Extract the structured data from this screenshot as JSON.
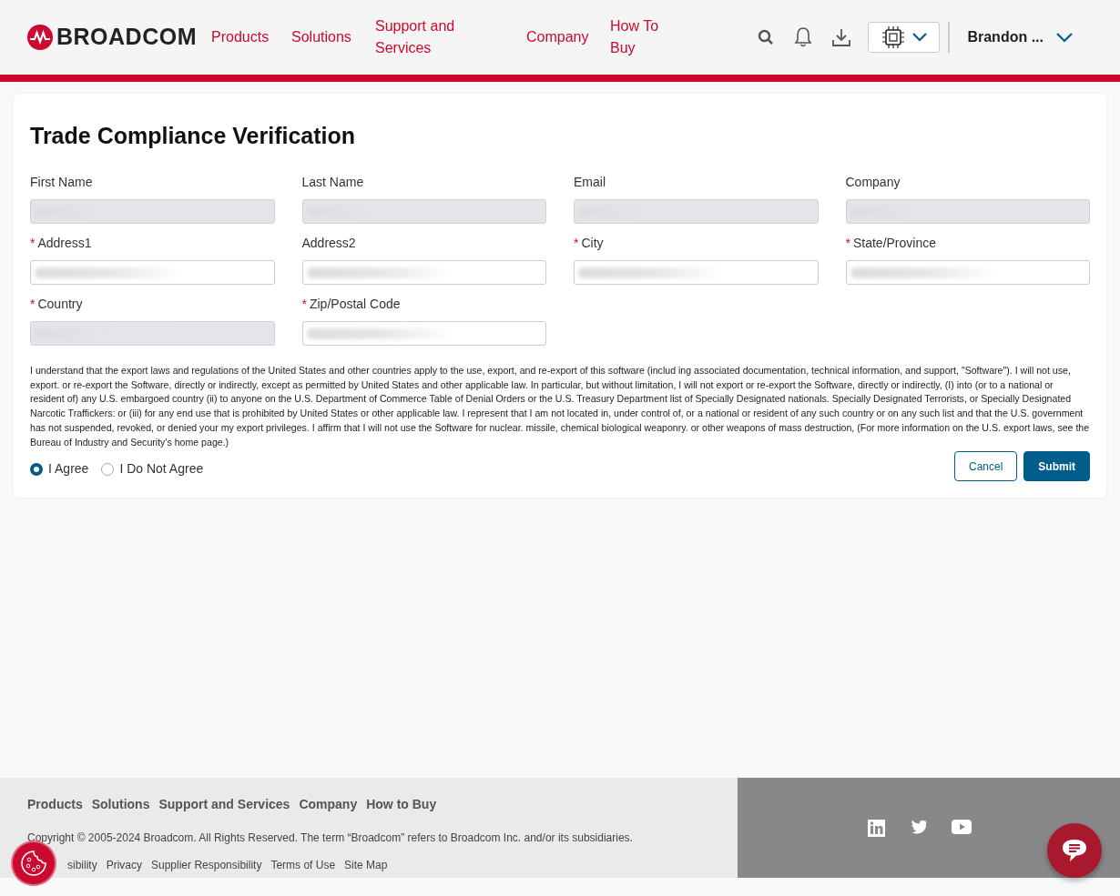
{
  "header": {
    "logo": "BROADCOM",
    "nav": [
      {
        "label": "Products"
      },
      {
        "label": "Solutions"
      },
      {
        "label": "Support and Services"
      },
      {
        "label": "Company"
      },
      {
        "label": "How To Buy"
      }
    ],
    "user": "Brandon ..."
  },
  "form": {
    "title": "Trade Compliance Verification",
    "fields": [
      {
        "label": "First Name",
        "required": false,
        "disabled": true,
        "redacted": true
      },
      {
        "label": "Last Name",
        "required": false,
        "disabled": true,
        "redacted": true
      },
      {
        "label": "Email",
        "required": false,
        "disabled": true,
        "redacted": true
      },
      {
        "label": "Company",
        "required": false,
        "disabled": true,
        "redacted": true
      },
      {
        "label": "Address1",
        "required": true,
        "disabled": false,
        "redacted": true
      },
      {
        "label": "Address2",
        "required": false,
        "disabled": false,
        "redacted": true
      },
      {
        "label": "City",
        "required": true,
        "disabled": false,
        "redacted": true
      },
      {
        "label": "State/Province",
        "required": true,
        "disabled": false,
        "redacted": true
      },
      {
        "label": "Country",
        "required": true,
        "disabled": true,
        "redacted": true
      },
      {
        "label": "Zip/Postal Code",
        "required": true,
        "disabled": false,
        "redacted": true
      }
    ],
    "required_mark": "*",
    "legal_text": "I understand that the export laws and regulations of the United States and other countries apply to the use, export, and re-export of this software (includ ing associated documentation, technical information, and support, \"Software\"). I will not use, export. or re-export the Software, directly or indirectly, except as permitted by United States and other applicable law. In particular, but without limitation, I will not export or re-export the Software, directly or indirectly, (I) into (or to a national or resident of) any U.S. embargoed country (ii) to anyone on the U.S. Department of Commerce Table of Denial Orders or the U.S. Treasury Department list of Specially Designated nationals. Specially Designated Terrorists, or Specially Designated Narcotic Traffickers: or (iii) for any end use that is prohibited by United States or other applicable law. I represent that I am not located in, under control of, or a national or resident of any such country or on any such list and that the U.S. government has not suspended, revoked, or denied your my export privileges. I affirm that I will not use the Software for nuclear. missile, chemical biological weaponry. or other weapons of mass destruction, (For more information on the U.S. export laws, see the Bureau of Industry and Security's home page.)",
    "options": [
      {
        "label": "I Agree",
        "selected": true
      },
      {
        "label": "I Do Not Agree",
        "selected": false
      }
    ],
    "buttons": [
      {
        "label": "Cancel",
        "kind": "secondary"
      },
      {
        "label": "Submit",
        "kind": "primary"
      }
    ]
  },
  "footer": {
    "nav": [
      "Products",
      "Solutions",
      "Support and Services",
      "Company",
      "How to Buy"
    ],
    "copyright": "Copyright © 2005-2024 Broadcom. All Rights Reserved. The term “Broadcom” refers to Broadcom Inc. and/or its subsidiaries.",
    "links": [
      "sibility",
      "Privacy",
      "Supplier Responsibility",
      "Terms of Use",
      "Site Map"
    ]
  }
}
